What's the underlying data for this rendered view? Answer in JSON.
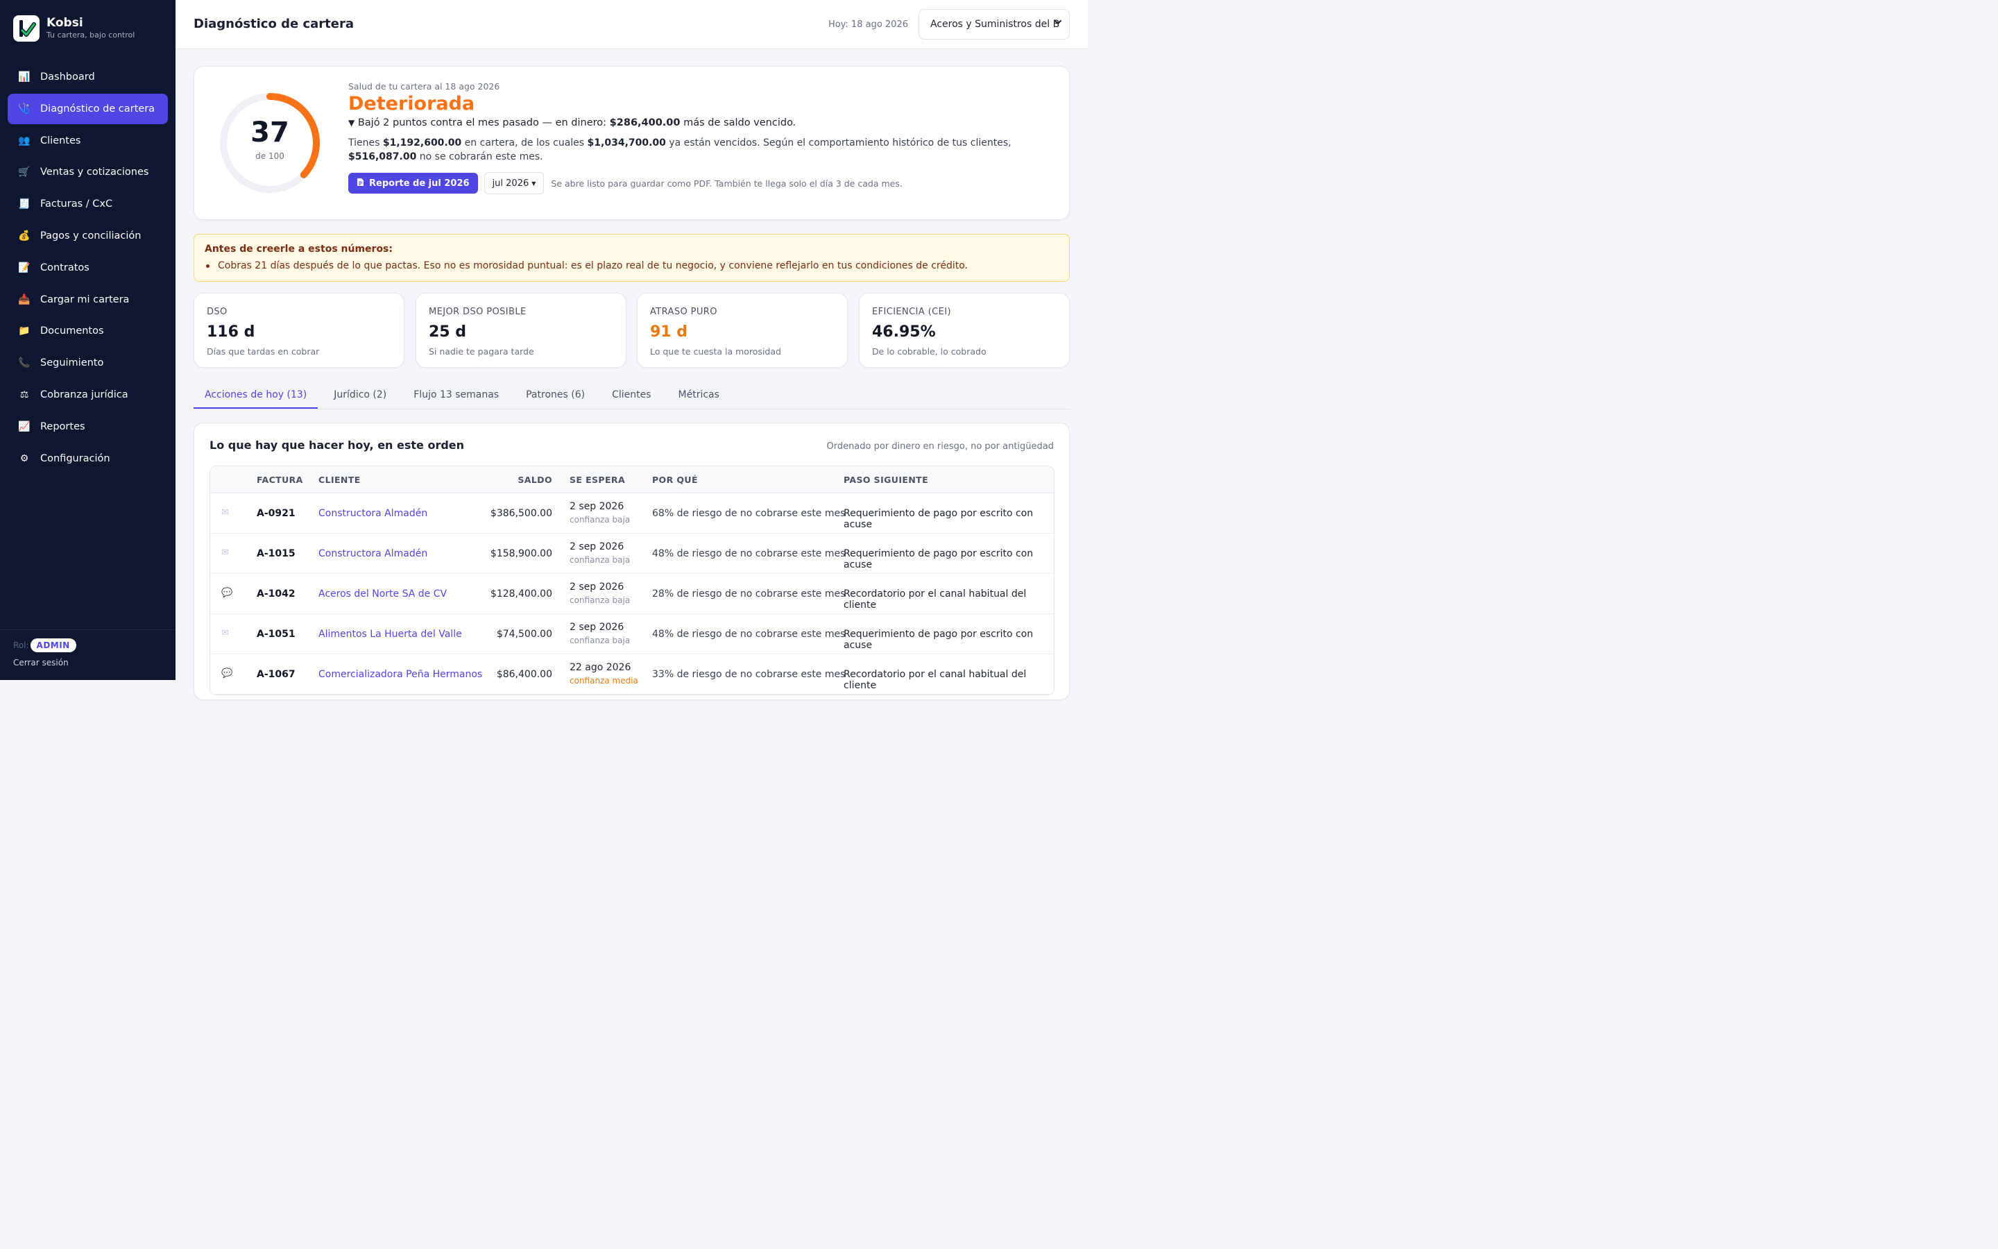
{
  "brand": {
    "name": "Kobsi",
    "tagline": "Tu cartera, bajo control"
  },
  "sidebar": {
    "items": [
      {
        "label": "Dashboard",
        "icon": "bar-chart-icon",
        "glyph": "📊"
      },
      {
        "label": "Diagnóstico de cartera",
        "icon": "stethoscope-icon",
        "glyph": "🩺",
        "active": true
      },
      {
        "label": "Clientes",
        "icon": "users-icon",
        "glyph": "👥"
      },
      {
        "label": "Ventas y cotizaciones",
        "icon": "cart-icon",
        "glyph": "🛒"
      },
      {
        "label": "Facturas / CxC",
        "icon": "receipt-icon",
        "glyph": "🧾"
      },
      {
        "label": "Pagos y conciliación",
        "icon": "money-bag-icon",
        "glyph": "💰"
      },
      {
        "label": "Contratos",
        "icon": "contract-icon",
        "glyph": "📝"
      },
      {
        "label": "Cargar mi cartera",
        "icon": "inbox-upload-icon",
        "glyph": "📥"
      },
      {
        "label": "Documentos",
        "icon": "folder-icon",
        "glyph": "📁"
      },
      {
        "label": "Seguimiento",
        "icon": "phone-icon",
        "glyph": "📞"
      },
      {
        "label": "Cobranza jurídica",
        "icon": "scales-icon",
        "glyph": "⚖"
      },
      {
        "label": "Reportes",
        "icon": "trend-chart-icon",
        "glyph": "📈"
      },
      {
        "label": "Configuración",
        "icon": "gear-icon",
        "glyph": "⚙"
      }
    ],
    "role_label": "Rol:",
    "role": "ADMIN",
    "logout": "Cerrar sesión"
  },
  "header": {
    "title": "Diagnóstico de cartera",
    "today": "Hoy: 18 ago 2026",
    "company": "Aceros y Suministros del B"
  },
  "health": {
    "score": 37,
    "score_max": "de 100",
    "score_fraction": 0.37,
    "date_label": "Salud de tu cartera al 18 ago 2026",
    "status": "Deteriorada",
    "delta_prefix": "Bajó 2 puntos contra el mes pasado — en dinero: ",
    "delta_amount": "$286,400.00",
    "delta_suffix": " más de saldo vencido.",
    "desc_1": "Tienes ",
    "desc_total": "$1,192,600.00",
    "desc_2": " en cartera, de los cuales ",
    "desc_overdue": "$1,034,700.00",
    "desc_3": " ya están vencidos. Según el comportamiento histórico de tus clientes, ",
    "desc_lost": "$516,087.00",
    "desc_4": " no se cobrarán este mes.",
    "report_button": "Reporte de jul 2026",
    "month": "jul 2026",
    "report_note": "Se abre listo para guardar como PDF. También te llega solo el día 3 de cada mes.",
    "accent": "#f97316"
  },
  "warning": {
    "title": "Antes de creerle a estos números:",
    "item": "Cobras 21 días después de lo que pactas. Eso no es morosidad puntual: es el plazo real de tu negocio, y conviene reflejarlo en tus condiciones de crédito."
  },
  "kpis": [
    {
      "label": "DSO",
      "value": "116 d",
      "desc": "Días que tardas en cobrar"
    },
    {
      "label": "MEJOR DSO POSIBLE",
      "value": "25 d",
      "desc": "Si nadie te pagara tarde"
    },
    {
      "label": "ATRASO PURO",
      "value": "91 d",
      "desc": "Lo que te cuesta la morosidad"
    },
    {
      "label": "EFICIENCIA (CEI)",
      "value": "46.95%",
      "desc": "De lo cobrable, lo cobrado"
    }
  ],
  "tabs": [
    "Acciones de hoy (13)",
    "Jurídico (2)",
    "Flujo 13 semanas",
    "Patrones (6)",
    "Clientes",
    "Métricas"
  ],
  "actions": {
    "title": "Lo que hay que hacer hoy, en este orden",
    "note": "Ordenado por dinero en riesgo, no por antigüedad",
    "columns": {
      "factura": "FACTURA",
      "cliente": "CLIENTE",
      "saldo": "SALDO",
      "espera": "SE ESPERA",
      "por": "POR QUÉ",
      "paso": "PASO SIGUIENTE"
    },
    "rows": [
      {
        "icon": "envelope-icon",
        "glyph": "✉",
        "factura": "A-0921",
        "cliente": "Constructora Almadén",
        "saldo": "$386,500.00",
        "fecha": "2 sep 2026",
        "confianza": "confianza baja",
        "por": "68% de riesgo de no cobrarse este mes",
        "paso": "Requerimiento de pago por escrito con acuse"
      },
      {
        "icon": "envelope-icon",
        "glyph": "✉",
        "factura": "A-1015",
        "cliente": "Constructora Almadén",
        "saldo": "$158,900.00",
        "fecha": "2 sep 2026",
        "confianza": "confianza baja",
        "por": "48% de riesgo de no cobrarse este mes",
        "paso": "Requerimiento de pago por escrito con acuse"
      },
      {
        "icon": "chat-bubble-icon",
        "glyph": "💬",
        "factura": "A-1042",
        "cliente": "Aceros del Norte SA de CV",
        "saldo": "$128,400.00",
        "fecha": "2 sep 2026",
        "confianza": "confianza baja",
        "por": "28% de riesgo de no cobrarse este mes",
        "paso": "Recordatorio por el canal habitual del cliente"
      },
      {
        "icon": "envelope-icon",
        "glyph": "✉",
        "factura": "A-1051",
        "cliente": "Alimentos La Huerta del Valle",
        "saldo": "$74,500.00",
        "fecha": "2 sep 2026",
        "confianza": "confianza baja",
        "por": "48% de riesgo de no cobrarse este mes",
        "paso": "Requerimiento de pago por escrito con acuse"
      },
      {
        "icon": "chat-bubble-icon",
        "glyph": "💬",
        "factura": "A-1067",
        "cliente": "Comercializadora Peña Hermanos",
        "saldo": "$86,400.00",
        "fecha": "22 ago 2026",
        "confianza": "confianza media",
        "por": "33% de riesgo de no cobrarse este mes",
        "paso": "Recordatorio por el canal habitual del cliente"
      }
    ]
  }
}
